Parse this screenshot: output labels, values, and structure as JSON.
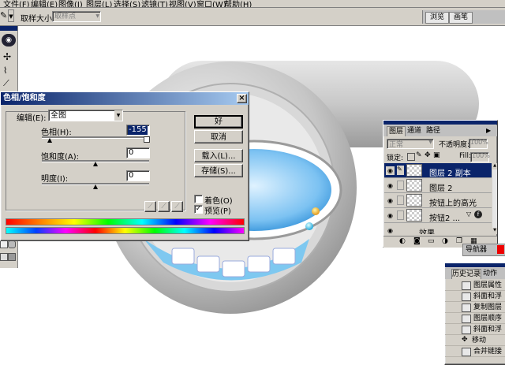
{
  "menubar": {
    "items": [
      {
        "label": "文件(F)"
      },
      {
        "label": "编辑(E)"
      },
      {
        "label": "图像(I)"
      },
      {
        "label": "图层(L)"
      },
      {
        "label": "选择(S)"
      },
      {
        "label": "滤镜(T)"
      },
      {
        "label": "视图(V)"
      },
      {
        "label": "窗口(W)"
      },
      {
        "label": "帮助(H)"
      }
    ]
  },
  "options_bar": {
    "sample_size_label": "取样大小:",
    "sample_size_value": "取样点",
    "palette_tabs": [
      "浏览",
      "画笔"
    ]
  },
  "hue_dialog": {
    "title": "色相/饱和度",
    "edit_label": "编辑(E):",
    "edit_value": "全图",
    "hue_label": "色相(H):",
    "hue_value": "-155",
    "hue_fraction": 0.07,
    "saturation_label": "饱和度(A):",
    "saturation_value": "0",
    "saturation_fraction": 0.5,
    "lightness_label": "明度(I):",
    "lightness_value": "0",
    "lightness_fraction": 0.5,
    "buttons": {
      "ok": "好",
      "cancel": "取消",
      "load": "载入(L)...",
      "save": "存储(S)..."
    },
    "colorize_label": "着色(O)",
    "colorize_checked": false,
    "preview_label": "预览(P)",
    "preview_checked": true
  },
  "layers_panel": {
    "tabs": [
      "图层",
      "通道",
      "路径"
    ],
    "blend_mode": "正常",
    "opacity_label": "不透明度:",
    "opacity_value": "100%",
    "lock_label": "锁定:",
    "fill_label": "Fill:",
    "fill_value": "100%",
    "layers": [
      {
        "name": "图层 2 副本",
        "selected": true
      },
      {
        "name": "图层 2",
        "selected": false
      },
      {
        "name": "按钮上的高光",
        "selected": false
      },
      {
        "name": "按钮2 ...",
        "selected": false
      }
    ],
    "effects_label": "效果"
  },
  "navigator_tab": "导航器",
  "history_panel": {
    "tabs": [
      "历史记录",
      "动作"
    ],
    "items": [
      "图层属性",
      "斜面和浮",
      "复制图层",
      "图层顺序",
      "斜面和浮",
      "移动",
      "合并链接"
    ]
  }
}
